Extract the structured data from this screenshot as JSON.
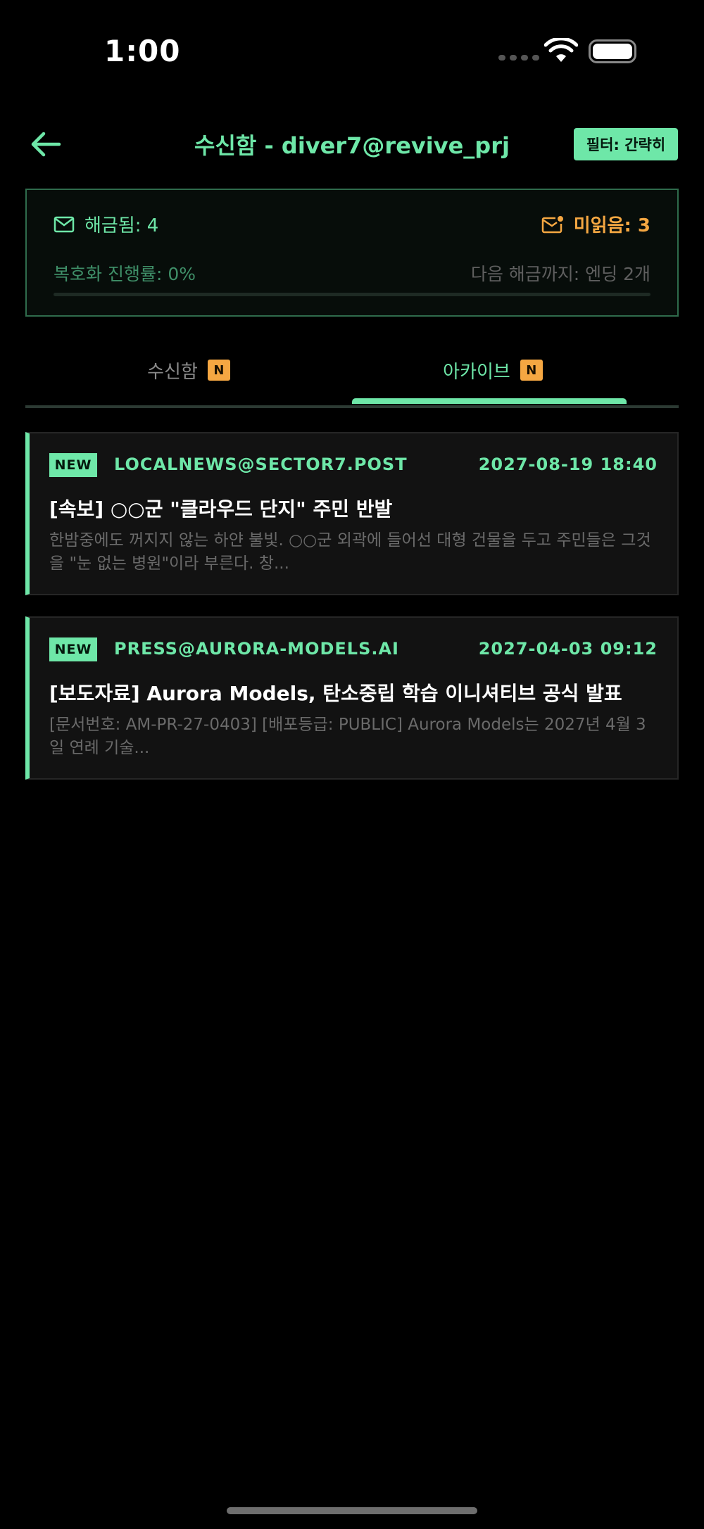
{
  "status_bar": {
    "time": "1:00"
  },
  "nav": {
    "title": "수신함 - diver7@revive_prj",
    "filter_label": "필터: 간략히"
  },
  "summary": {
    "unlocked_label": "해금됨: 4",
    "unread_label": "미읽음: 3",
    "progress_label": "복호화 진행률: 0%",
    "progress_value": 0,
    "next_unlock_label": "다음 해금까지: 엔딩 2개"
  },
  "tabs": [
    {
      "label": "수신함",
      "badge": "N",
      "active": false
    },
    {
      "label": "아카이브",
      "badge": "N",
      "active": true
    }
  ],
  "messages": [
    {
      "tag": "NEW",
      "sender": "LOCALNEWS@SECTOR7.POST",
      "date": "2027-08-19 18:40",
      "subject": "[속보] ○○군 \"클라우드 단지\" 주민 반발",
      "preview": "한밤중에도 꺼지지 않는 하얀 불빛. ○○군 외곽에 들어선 대형 건물을 두고 주민들은 그것을 \"눈 없는 병원\"이라 부른다.  창..."
    },
    {
      "tag": "NEW",
      "sender": "PRESS@AURORA-MODELS.AI",
      "date": "2027-04-03 09:12",
      "subject": "[보도자료] Aurora Models, 탄소중립 학습 이니셔티브 공식 발표",
      "preview": "[문서번호: AM-PR-27-0403] [배포등급: PUBLIC]  Aurora Models는 2027년 4월 3일 연례 기술..."
    }
  ],
  "colors": {
    "accent": "#6EE7A8",
    "warning": "#F5A742",
    "background": "#000000",
    "card": "#121212"
  }
}
